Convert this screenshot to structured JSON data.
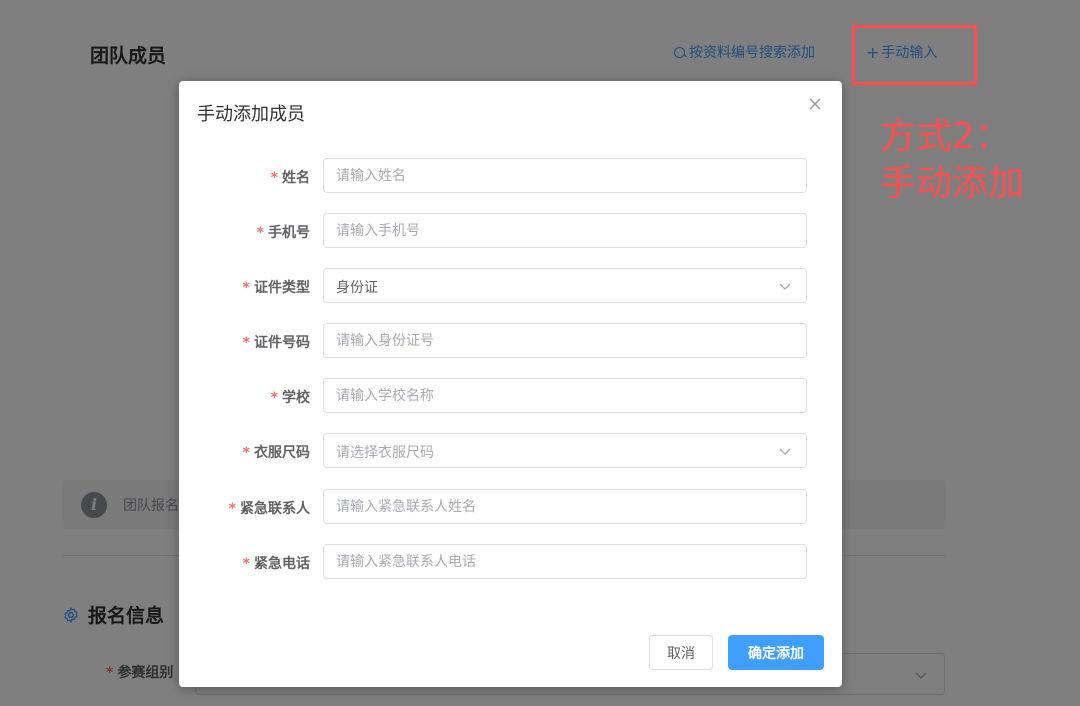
{
  "background": {
    "team_title": "团队成员",
    "search_add": "按资料编号搜索添加",
    "manual_add": "手动输入",
    "info_text": "团队报名",
    "section_title": "报名信息",
    "group_label": "参赛组别"
  },
  "annotation": {
    "line1": "方式2：",
    "line2": "手动添加",
    "color": "#ff4d4f"
  },
  "dialog": {
    "title": "手动添加成员",
    "fields": [
      {
        "label": "姓名",
        "placeholder": "请输入姓名",
        "type": "input"
      },
      {
        "label": "手机号",
        "placeholder": "请输入手机号",
        "type": "input"
      },
      {
        "label": "证件类型",
        "value": "身份证",
        "type": "select"
      },
      {
        "label": "证件号码",
        "placeholder": "请输入身份证号",
        "type": "input"
      },
      {
        "label": "学校",
        "placeholder": "请输入学校名称",
        "type": "input"
      },
      {
        "label": "衣服尺码",
        "placeholder": "请选择衣服尺码",
        "type": "select"
      },
      {
        "label": "紧急联系人",
        "placeholder": "请输入紧急联系人姓名",
        "type": "input"
      },
      {
        "label": "紧急电话",
        "placeholder": "请输入紧急联系人电话",
        "type": "input"
      }
    ],
    "required_mark": "*",
    "cancel_label": "取消",
    "confirm_label": "确定添加"
  },
  "colors": {
    "primary": "#409eff",
    "danger": "#f56c6c",
    "overlay": "rgba(0,0,0,0.5)"
  },
  "icons": {
    "search": "search-icon",
    "plus": "plus-icon",
    "info": "info-icon",
    "gear": "gear-icon",
    "close": "close-icon",
    "chevron": "chevron-down-icon"
  }
}
